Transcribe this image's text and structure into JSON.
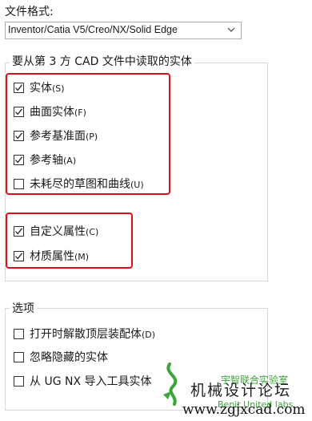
{
  "file_format": {
    "label": "文件格式:",
    "selected": "Inventor/Catia V5/Creo/NX/Solid Edge"
  },
  "read_group": {
    "title": "要从第 3 方 CAD 文件中读取的实体",
    "items": [
      {
        "label": "实体",
        "key": "(S)",
        "checked": true
      },
      {
        "label": "曲面实体",
        "key": "(F)",
        "checked": true
      },
      {
        "label": "参考基准面",
        "key": "(P)",
        "checked": true
      },
      {
        "label": "参考轴",
        "key": "(A)",
        "checked": true
      },
      {
        "label": "未耗尽的草图和曲线",
        "key": "(U)",
        "checked": false
      },
      {
        "label": "自定义属性",
        "key": "(C)",
        "checked": true
      },
      {
        "label": "材质属性",
        "key": "(M)",
        "checked": true
      }
    ]
  },
  "options_group": {
    "title": "选项",
    "items": [
      {
        "label": "打开时解散顶层装配体",
        "key": "(D)",
        "checked": false
      },
      {
        "label": "忽略隐藏的实体",
        "key": "",
        "checked": false
      },
      {
        "label": "从 UG NX 导入工具实体",
        "key": "",
        "checked": false
      }
    ]
  },
  "watermark": {
    "cn": "机械设计论坛",
    "url": "www.zgjxcad.com",
    "lab_cn": "宇智联合实验室",
    "lab_en": "Benit United labs"
  },
  "colors": {
    "highlight": "#e0101a",
    "watermark_green": "#3aa63a"
  }
}
